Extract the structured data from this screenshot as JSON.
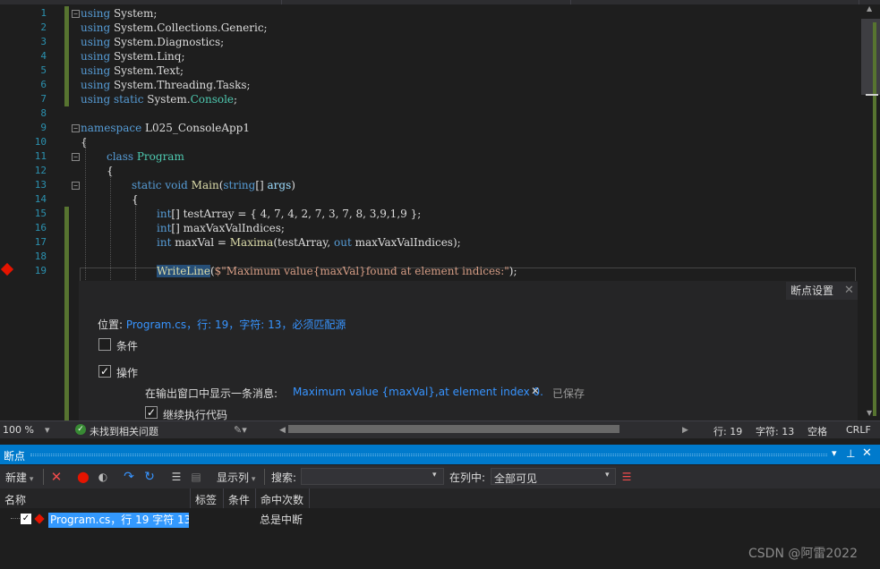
{
  "editor": {
    "line_numbers": [
      "1",
      "2",
      "3",
      "4",
      "5",
      "6",
      "7",
      "8",
      "9",
      "10",
      "11",
      "12",
      "13",
      "14",
      "15",
      "16",
      "17",
      "18",
      "19"
    ],
    "lines": {
      "l1": {
        "kw": "using",
        "rest": " System;"
      },
      "l2": {
        "kw": "using",
        "rest": " System.Collections.Generic;"
      },
      "l3": {
        "kw": "using",
        "rest": " System.Diagnostics;"
      },
      "l4": {
        "kw": "using",
        "rest": " System.Linq;"
      },
      "l5": {
        "kw": "using",
        "rest": " System.Text;"
      },
      "l6": {
        "kw": "using",
        "rest": " System.Threading.Tasks;"
      },
      "l7": {
        "kw": "using",
        "kw2": " static",
        "mid": " System.",
        "ty": "Console",
        "end": ";"
      },
      "l9": {
        "kw": "namespace",
        "rest": " L025_ConsoleApp1"
      },
      "l10": "{",
      "l11": {
        "kw": "class",
        "ty": " Program"
      },
      "l12": "{",
      "l13": {
        "kw": "static",
        "kw2": " void",
        "fn": " Main",
        "p1": "(",
        "kw3": "string",
        "p2": "[] ",
        "pm": "args",
        "p3": ")"
      },
      "l14": "{",
      "l15": {
        "kw": "int",
        "rest": "[] testArray = { 4, 7, 4, 2, 7, 3, 7, 8, 3,9,1,9 };"
      },
      "l16": {
        "kw": "int",
        "rest": "[] maxVaxValIndices;"
      },
      "l17": {
        "kw": "int",
        "mid": " maxVal = ",
        "fn": "Maxima",
        "mid2": "(testArray, ",
        "kw2": "out",
        "end": " maxVaxValIndices);"
      },
      "l19": {
        "fn": "WriteLine",
        "p1": "(",
        "st": "$\"Maximum value{maxVal}found at element indices:\"",
        "p2": ");"
      }
    }
  },
  "breakpoint_settings": {
    "tab_label": "断点设置",
    "location_label": "位置: ",
    "location_value": "Program.cs，行: 19，字符: 13，必须匹配源",
    "condition_label": "条件",
    "action_label": "操作",
    "action_desc": "在输出窗口中显示一条消息:",
    "message": "Maximum value {maxVal},at element index 0.",
    "saved": "已保存",
    "continue_label": "继续执行代码"
  },
  "statusbar": {
    "zoom": "100 %",
    "issues": "未找到相关问题",
    "line": "行: 19",
    "char": "字符: 13",
    "spaces": "空格",
    "eol": "CRLF"
  },
  "breakpoints_window": {
    "title": "断点",
    "toolbar": {
      "new_label": "新建",
      "columns_label": "显示列",
      "search_label": "搜索:",
      "search_value": "",
      "in_column_label": "在列中:",
      "in_column_value": "全部可见"
    },
    "columns": [
      "名称",
      "标签",
      "条件",
      "命中次数"
    ],
    "rows": [
      {
        "name": "Program.cs，行 19 字符 13",
        "tag": "",
        "condition": "",
        "hit_count": "总是中断",
        "checked": true
      }
    ]
  },
  "watermark": "CSDN @阿雷2022",
  "colors": {
    "accent": "#007acc",
    "breakpoint": "#e51400",
    "link": "#3794ff",
    "selection": "#3399ff"
  }
}
